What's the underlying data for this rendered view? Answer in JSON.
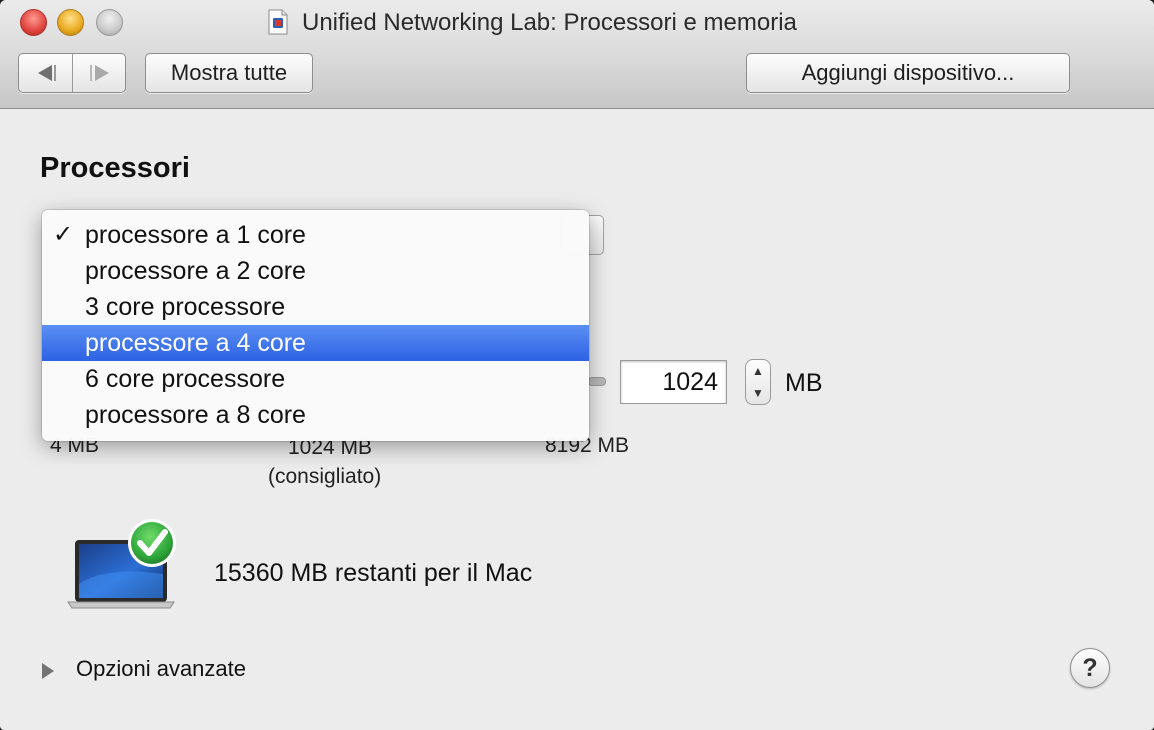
{
  "window": {
    "title": "Unified Networking Lab: Processori e memoria"
  },
  "toolbar": {
    "back_icon": "back-arrow-icon",
    "forward_icon": "forward-arrow-icon",
    "show_all_label": "Mostra tutte",
    "add_device_label": "Aggiungi dispositivo..."
  },
  "processors": {
    "section_title": "Processori",
    "menu": {
      "check_glyph": "✓",
      "items": [
        {
          "label": "processore a 1 core",
          "checked": true,
          "highlighted": false
        },
        {
          "label": "processore a 2 core",
          "checked": false,
          "highlighted": false
        },
        {
          "label": "3 core processore",
          "checked": false,
          "highlighted": false
        },
        {
          "label": "processore a 4 core",
          "checked": false,
          "highlighted": true
        },
        {
          "label": "6 core processore",
          "checked": false,
          "highlighted": false
        },
        {
          "label": "processore a 8 core",
          "checked": false,
          "highlighted": false
        }
      ],
      "highlight_color": "#3b73e8"
    }
  },
  "memory": {
    "value": "1024",
    "unit": "MB",
    "min_label": "4 MB",
    "recommended_label": "1024 MB",
    "recommended_note": "(consigliato)",
    "max_label": "8192 MB",
    "status_text": "15360 MB restanti per il Mac",
    "status_icon": "checkmark-badge-icon",
    "status_color": "#2fa63a"
  },
  "footer": {
    "advanced_label": "Opzioni avanzate",
    "help_label": "?"
  }
}
